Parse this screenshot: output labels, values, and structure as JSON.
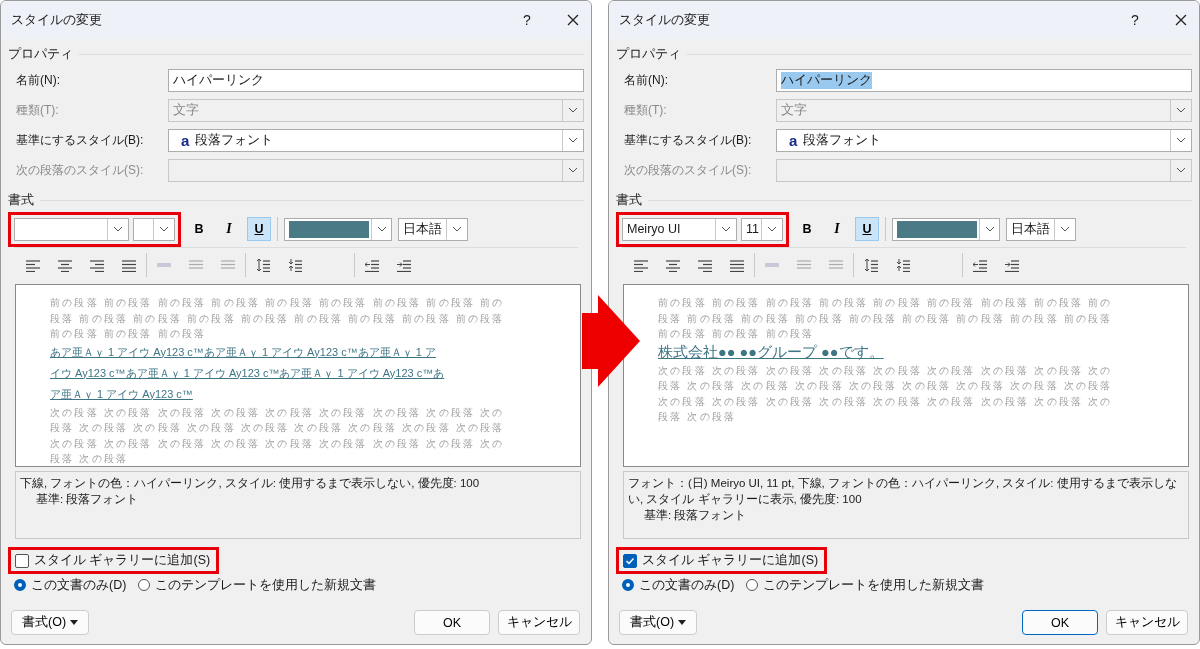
{
  "dialogs": [
    {
      "title": "スタイルの変更",
      "help": "?",
      "properties_label": "プロパティ",
      "fields": [
        {
          "kind": "text",
          "label": "名前(N):",
          "value": "ハイパーリンク",
          "disabled": false,
          "selected": false
        },
        {
          "kind": "combo",
          "label": "種類(T):",
          "value": "文字",
          "disabled": true
        },
        {
          "kind": "style-combo",
          "label": "基準にするスタイル(B):",
          "glyph": "a",
          "value": "段落フォント",
          "disabled": false
        },
        {
          "kind": "combo",
          "label": "次の段落のスタイル(S):",
          "disabled": true
        }
      ],
      "format_label": "書式",
      "font_controls": {
        "highlighted": true
      },
      "styles": [
        {
          "label": "B",
          "selected": false
        },
        {
          "label": "I",
          "selected": false
        },
        {
          "label": "U",
          "selected": true
        }
      ],
      "language": "日本語",
      "preview": {
        "before": [
          "前の段落 前の段落 前の段落 前の段落 前の段落 前の段落 前の段落 前の段落 前の",
          "段落 前の段落 前の段落 前の段落 前の段落 前の段落 前の段落 前の段落 前の段落",
          "前の段落 前の段落 前の段落"
        ],
        "sample": [
          "あア亜Ａｙ 1 アイウ Ay123 c™あア亜Ａｙ 1 アイウ Ay123 c™あア亜Ａｙ 1 ア",
          "イウ Ay123 c™あア亜Ａｙ 1 アイウ Ay123 c™あア亜Ａｙ 1 アイウ Ay123 c™あ",
          "ア亜Ａｙ 1 アイウ Ay123 c™"
        ],
        "after": [
          "次の段落 次の段落 次の段落 次の段落 次の段落 次の段落 次の段落 次の段落 次の",
          "段落 次の段落 次の段落 次の段落 次の段落 次の段落 次の段落 次の段落 次の段落",
          "次の段落 次の段落 次の段落 次の段落 次の段落 次の段落 次の段落 次の段落 次の",
          "段落 次の段落"
        ]
      },
      "description": [
        "下線, フォントの色：ハイパーリンク, スタイル: 使用するまで表示しない, 優先度: 100",
        "基準: 段落フォント"
      ],
      "gallery": {
        "label": "スタイル ギャラリーに追加(S)",
        "checked": false,
        "highlighted": true
      },
      "scope": [
        {
          "label": "この文書のみ(D)",
          "selected": true
        },
        {
          "label": "このテンプレートを使用した新規文書",
          "selected": false
        }
      ],
      "format_button": "書式(O)",
      "ok": "OK",
      "ok_default": false,
      "cancel": "キャンセル"
    },
    {
      "title": "スタイルの変更",
      "help": "?",
      "properties_label": "プロパティ",
      "fields": [
        {
          "kind": "text",
          "label": "名前(N):",
          "value": "ハイパーリンク",
          "disabled": false,
          "selected": true
        },
        {
          "kind": "combo",
          "label": "種類(T):",
          "value": "文字",
          "disabled": true
        },
        {
          "kind": "style-combo",
          "label": "基準にするスタイル(B):",
          "glyph": "a",
          "value": "段落フォント",
          "disabled": false
        },
        {
          "kind": "combo",
          "label": "次の段落のスタイル(S):",
          "disabled": true
        }
      ],
      "format_label": "書式",
      "font_controls": {
        "highlighted": true,
        "font": "Meiryo UI",
        "size": "11"
      },
      "styles": [
        {
          "label": "B",
          "selected": false
        },
        {
          "label": "I",
          "selected": false
        },
        {
          "label": "U",
          "selected": true
        }
      ],
      "language": "日本語",
      "preview": {
        "before": [
          "前の段落 前の段落 前の段落 前の段落 前の段落 前の段落 前の段落 前の段落 前の",
          "段落 前の段落 前の段落 前の段落 前の段落 前の段落 前の段落 前の段落 前の段落",
          "前の段落 前の段落 前の段落"
        ],
        "sample": [
          "株式会社●● ●●グループ ●●です。"
        ],
        "after": [
          "次の段落 次の段落 次の段落 次の段落 次の段落 次の段落 次の段落 次の段落 次の",
          "段落 次の段落 次の段落 次の段落 次の段落 次の段落 次の段落 次の段落 次の段落",
          "次の段落 次の段落 次の段落 次の段落 次の段落 次の段落 次の段落 次の段落 次の",
          "段落 次の段落"
        ]
      },
      "description": [
        "フォント：(日) Meiryo UI, 11 pt, 下線, フォントの色：ハイパーリンク, スタイル: 使用するまで表示しない, スタイル ギャラリーに表示, 優先度: 100",
        "基準: 段落フォント"
      ],
      "gallery": {
        "label": "スタイル ギャラリーに追加(S)",
        "checked": true,
        "highlighted": true
      },
      "scope": [
        {
          "label": "この文書のみ(D)",
          "selected": true
        },
        {
          "label": "このテンプレートを使用した新規文書",
          "selected": false
        }
      ],
      "format_button": "書式(O)",
      "ok": "OK",
      "ok_default": true,
      "cancel": "キャンセル"
    }
  ]
}
